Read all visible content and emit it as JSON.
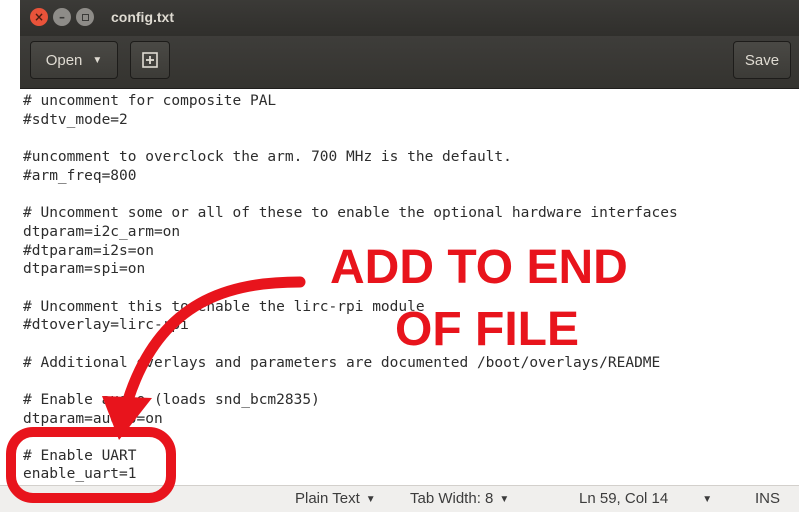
{
  "window": {
    "title": "config.txt"
  },
  "headerbar": {
    "open_label": "Open",
    "save_label": "Save"
  },
  "editor": {
    "lines": [
      "# uncomment for composite PAL",
      "#sdtv_mode=2",
      "",
      "#uncomment to overclock the arm. 700 MHz is the default.",
      "#arm_freq=800",
      "",
      "# Uncomment some or all of these to enable the optional hardware interfaces",
      "dtparam=i2c_arm=on",
      "#dtparam=i2s=on",
      "dtparam=spi=on",
      "",
      "# Uncomment this to enable the lirc-rpi module",
      "#dtoverlay=lirc-rpi",
      "",
      "# Additional overlays and parameters are documented /boot/overlays/README",
      "",
      "# Enable audio (loads snd_bcm2835)",
      "dtparam=audio=on",
      "",
      "# Enable UART",
      "enable_uart=1"
    ]
  },
  "statusbar": {
    "language": "Plain Text",
    "tab_width": "Tab Width: 8",
    "position": "Ln 59, Col 14",
    "mode": "INS"
  },
  "annotation": {
    "line1": "ADD TO END",
    "line2": "OF FILE",
    "color": "#e8141c"
  },
  "colors": {
    "titlebar": "#302f2c",
    "close_button": "#e9533a",
    "editor_bg": "#ffffff"
  }
}
